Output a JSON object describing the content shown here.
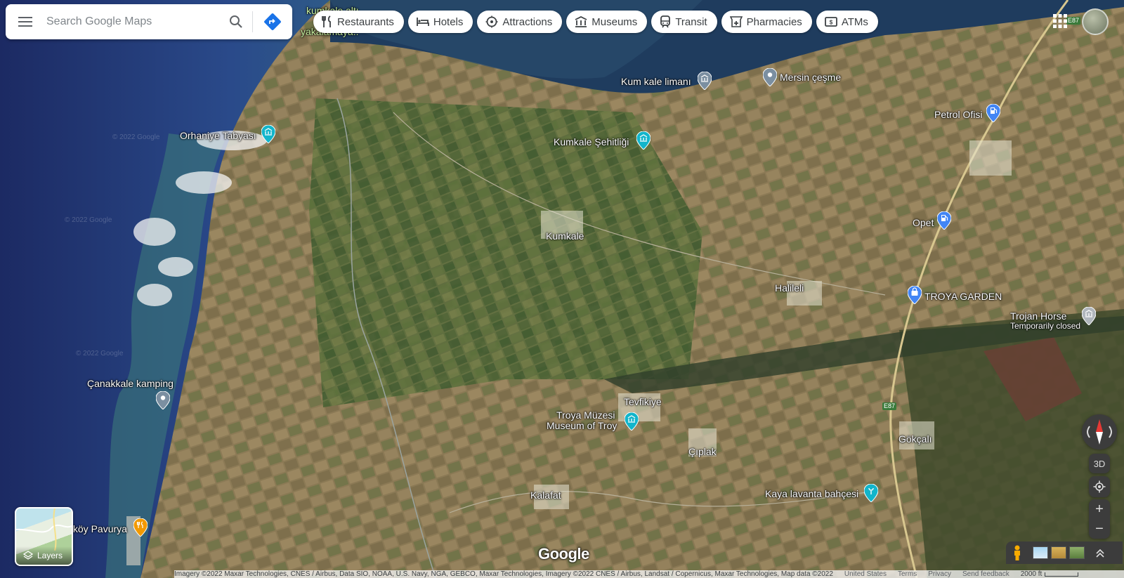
{
  "search": {
    "placeholder": "Search Google Maps"
  },
  "icons": {
    "menu": "hamburger-menu-icon",
    "search": "search-icon",
    "directions": "directions-icon",
    "apps": "google-apps-icon",
    "layers": "layers-icon",
    "pegman": "pegman-icon",
    "compass": "compass-icon",
    "my_location": "my-location-icon"
  },
  "chips": [
    {
      "label": "Restaurants",
      "icon": "restaurant-icon"
    },
    {
      "label": "Hotels",
      "icon": "hotel-icon"
    },
    {
      "label": "Attractions",
      "icon": "attraction-icon"
    },
    {
      "label": "Museums",
      "icon": "museum-icon"
    },
    {
      "label": "Transit",
      "icon": "transit-icon"
    },
    {
      "label": "Pharmacies",
      "icon": "pharmacy-icon"
    },
    {
      "label": "ATMs",
      "icon": "atm-icon"
    }
  ],
  "places": {
    "kumkale_alti": "kumkale altı",
    "kumkale_alti_2": "yakalamaya..",
    "kum_kale_limani": "Kum kale limanı",
    "mersin_cesme": "Mersin çeşme",
    "petrol_ofisi": "Petrol Ofisi",
    "orhaniye": "Orhaniye Tabyası",
    "kumkale_sehitligi": "Kumkale Şehitliği",
    "kumkale": "Kumkale",
    "opet": "Opet",
    "halileli": "Halileli",
    "troya_garden": "TROYA GARDEN",
    "trojan_horse": "Trojan Horse",
    "trojan_horse_status": "Temporarily closed",
    "canakkale_kamping": "Çanakkale kamping",
    "tevfikiye": "Tevfikiye",
    "troya_muzesi": "Troya Müzesi",
    "museum_of_troy": "Museum of Troy",
    "gokcali": "Gökçalı",
    "ciplak": "Çıplak",
    "kalafat": "Kalafat",
    "kaya_lavanta": "Kaya lavanta bahçesi",
    "pavurya": "ıköy Pavurya"
  },
  "road_shields": {
    "e87_a": "E87",
    "e87_b": "E87"
  },
  "watermarks": [
    "© 2022 Google",
    "© 2022 Google",
    "© 2022 Google"
  ],
  "layers": {
    "label": "Layers"
  },
  "controls": {
    "three_d": "3D",
    "zoom_in": "+",
    "zoom_out": "−"
  },
  "logo": "Google",
  "footer": {
    "attribution": "Imagery ©2022 Maxar Technologies, CNES / Airbus, Data SIO, NOAA, U.S. Navy, NGA, GEBCO, Maxar Technologies, Imagery ©2022 CNES / Airbus, Landsat / Copernicus, Maxar Technologies, Map data ©2022",
    "region": "United States",
    "terms": "Terms",
    "privacy": "Privacy",
    "feedback": "Send feedback",
    "scale": "2000 ft"
  },
  "colors": {
    "poi_museum": "#12b5cb",
    "poi_shop": "#4285f4",
    "poi_food": "#f29900",
    "poi_generic": "#7b8fa1",
    "directions": "#1a73e8"
  }
}
